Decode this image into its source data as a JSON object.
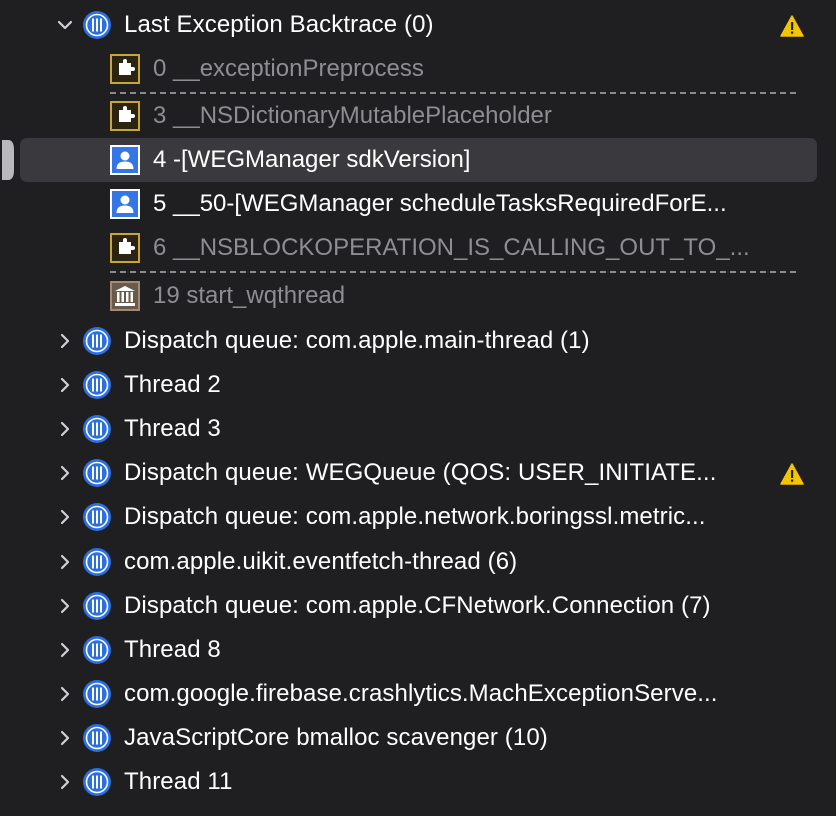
{
  "threads_expanded": {
    "label": "Last Exception Backtrace (0)",
    "has_warning": true,
    "frames": [
      {
        "label": "0 __exceptionPreprocess",
        "icon": "puzzle-icon",
        "style": "dim"
      },
      {
        "label": "3 __NSDictionaryMutablePlaceholder",
        "icon": "puzzle-icon",
        "style": "dim"
      },
      {
        "label": "4 -[WEGManager sdkVersion]",
        "icon": "user-code-icon",
        "style": "bright",
        "selected": true
      },
      {
        "label": "5 __50-[WEGManager scheduleTasksRequiredForE...",
        "icon": "user-code-icon",
        "style": "bright"
      },
      {
        "label": "6 __NSBLOCKOPERATION_IS_CALLING_OUT_TO_...",
        "icon": "puzzle-icon",
        "style": "dim"
      },
      {
        "label": "19 start_wqthread",
        "icon": "library-icon",
        "style": "dim"
      }
    ]
  },
  "threads_collapsed": [
    {
      "label": "Dispatch queue: com.apple.main-thread (1)"
    },
    {
      "label": "Thread 2"
    },
    {
      "label": "Thread 3"
    },
    {
      "label": "Dispatch queue: WEGQueue (QOS: USER_INITIATE...",
      "has_warning": true
    },
    {
      "label": "Dispatch queue: com.apple.network.boringssl.metric..."
    },
    {
      "label": "com.apple.uikit.eventfetch-thread (6)"
    },
    {
      "label": "Dispatch queue: com.apple.CFNetwork.Connection (7)"
    },
    {
      "label": "Thread 8"
    },
    {
      "label": "com.google.firebase.crashlytics.MachExceptionServe..."
    },
    {
      "label": "JavaScriptCore bmalloc scavenger (10)"
    },
    {
      "label": "Thread 11"
    }
  ],
  "colors": {
    "background": "#1f1f22",
    "selection": "#3a3a3e",
    "thread_icon": "#2b6fe0",
    "user_code_icon": "#3476e6",
    "system_frame_icon": "#c8a43a",
    "warning": "#f5c400"
  }
}
